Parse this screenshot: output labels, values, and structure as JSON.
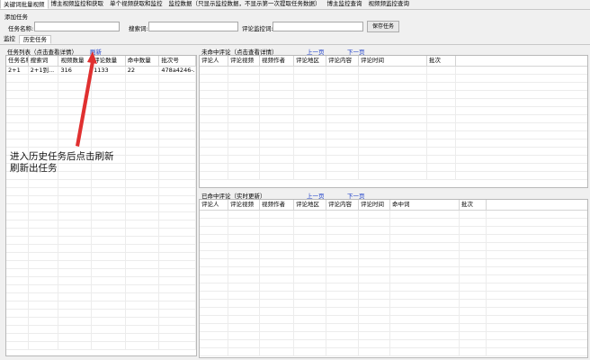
{
  "top_tabs": [
    "关键词批量视频",
    "博主视频监控和获取",
    "单个视频获取和监控",
    "监控数据（只显示监控数据，不显示第一次提取任务数据）",
    "博主监控查询",
    "视频频监控查询"
  ],
  "add_task": {
    "title": "添加任务",
    "task_name_label": "任务名称:",
    "task_name_value": "",
    "search_word_label": "搜索词:",
    "search_word_value": "",
    "comment_monitor_label": "评论监控词:",
    "comment_monitor_value": "",
    "save_button": "保存任务"
  },
  "sub_tabs": [
    "监控",
    "历史任务"
  ],
  "task_list": {
    "label": "任务列表（点击查看详情）",
    "refresh_link": "刷新",
    "columns": [
      "任务名称",
      "搜索词",
      "视频数量",
      "评论数量",
      "命中数量",
      "批次号"
    ],
    "rows": [
      [
        "2+1",
        "2+1到...",
        "316",
        "1133",
        "22",
        "478a4246-..."
      ]
    ]
  },
  "unhit_comments": {
    "label": "未命中评论（点击查看详情）",
    "prev_link": "上一页",
    "next_link": "下一页",
    "columns": [
      "评论人",
      "评论视频",
      "视频作者",
      "评论地区",
      "评论内容",
      "评论时间",
      "批次"
    ]
  },
  "hit_comments": {
    "label": "已命中评论（实时更新）",
    "prev_link": "上一页",
    "next_link": "下一页",
    "columns": [
      "评论人",
      "评论视频",
      "视频作者",
      "评论地区",
      "评论内容",
      "评论时间",
      "命中词",
      "批次"
    ]
  },
  "annotation": {
    "line1": "进入历史任务后点击刷新",
    "line2": "刷新出任务"
  },
  "colors": {
    "link": "#1c3ec8",
    "arrow": "#e03030"
  }
}
